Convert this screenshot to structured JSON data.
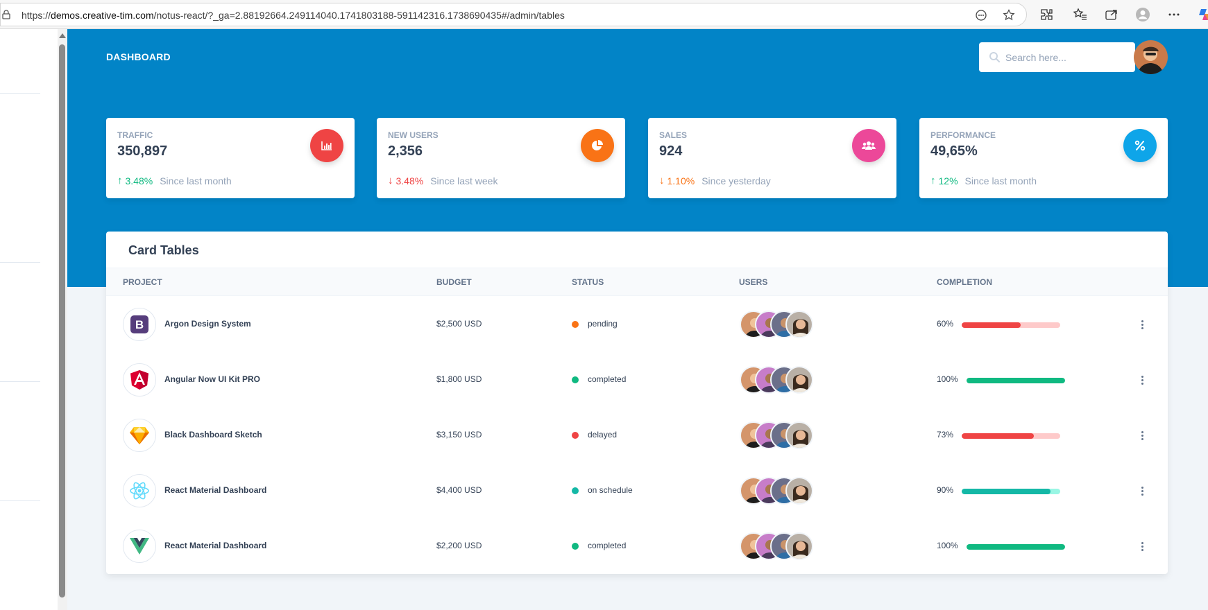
{
  "browser": {
    "url_prefix": "https://",
    "url_domain": "demos.creative-tim.com",
    "url_path": "/notus-react/?_ga=2.88192664.249114040.1741803188-591142316.1738690435#/admin/tables"
  },
  "header": {
    "title": "DASHBOARD",
    "search_placeholder": "Search here..."
  },
  "stats": [
    {
      "title": "TRAFFIC",
      "value": "350,897",
      "change": "3.48%",
      "direction": "up",
      "change_color": "#10b981",
      "since": "Since last month",
      "icon": "chart-bar-icon",
      "icon_bg": "#ef4444"
    },
    {
      "title": "NEW USERS",
      "value": "2,356",
      "change": "3.48%",
      "direction": "down",
      "change_color": "#ef4444",
      "since": "Since last week",
      "icon": "chart-pie-icon",
      "icon_bg": "#f97316"
    },
    {
      "title": "SALES",
      "value": "924",
      "change": "1.10%",
      "direction": "down",
      "change_color": "#f97316",
      "since": "Since yesterday",
      "icon": "users-icon",
      "icon_bg": "#ec4899"
    },
    {
      "title": "PERFORMANCE",
      "value": "49,65%",
      "change": "12%",
      "direction": "up",
      "change_color": "#10b981",
      "since": "Since last month",
      "icon": "percent-icon",
      "icon_bg": "#0ea5e9"
    }
  ],
  "table": {
    "title": "Card Tables",
    "columns": [
      "PROJECT",
      "BUDGET",
      "STATUS",
      "USERS",
      "COMPLETION"
    ],
    "rows": [
      {
        "project": "Argon Design System",
        "logo": "bootstrap-logo-icon",
        "budget": "$2,500 USD",
        "status": "pending",
        "status_color": "#f97316",
        "completion": "60%",
        "completion_value": 60,
        "bar_color": "#ef4444",
        "bar_bg": "#fecaca"
      },
      {
        "project": "Angular Now UI Kit PRO",
        "logo": "angular-logo-icon",
        "budget": "$1,800 USD",
        "status": "completed",
        "status_color": "#10b981",
        "completion": "100%",
        "completion_value": 100,
        "bar_color": "#10b981",
        "bar_bg": "#a7f3d0"
      },
      {
        "project": "Black Dashboard Sketch",
        "logo": "sketch-logo-icon",
        "budget": "$3,150 USD",
        "status": "delayed",
        "status_color": "#ef4444",
        "completion": "73%",
        "completion_value": 73,
        "bar_color": "#ef4444",
        "bar_bg": "#fecaca"
      },
      {
        "project": "React Material Dashboard",
        "logo": "react-logo-icon",
        "budget": "$4,400 USD",
        "status": "on schedule",
        "status_color": "#14b8a6",
        "completion": "90%",
        "completion_value": 90,
        "bar_color": "#14b8a6",
        "bar_bg": "#99f6e4"
      },
      {
        "project": "React Material Dashboard",
        "logo": "vue-logo-icon",
        "budget": "$2,200 USD",
        "status": "completed",
        "status_color": "#10b981",
        "completion": "100%",
        "completion_value": 100,
        "bar_color": "#10b981",
        "bar_bg": "#a7f3d0"
      }
    ]
  }
}
